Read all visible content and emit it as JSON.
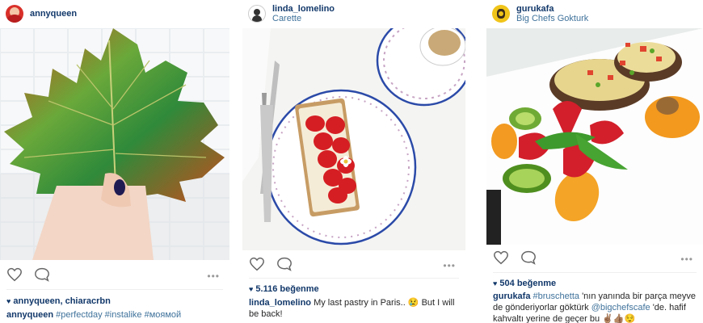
{
  "posts": [
    {
      "username": "annyqueen",
      "location": "",
      "likes_text": "annyqueen, chiaracrbn",
      "caption_user": "annyqueen",
      "caption_text": "#perfectday #instalike #моямой"
    },
    {
      "username": "linda_lomelino",
      "location": "Carette",
      "likes_text": "5.116 beğenme",
      "caption_user": "linda_lomelino",
      "caption_text": "My last pastry in Paris.. 😢 But I will be back!"
    },
    {
      "username": "gurukafa",
      "location": "Big Chefs Gokturk",
      "likes_text": "504 beğenme",
      "caption_user": "gurukafa",
      "caption_tag1": "#bruschetta",
      "caption_mid": "'nın yanında bir parça meyve de gönderiyorlar göktürk",
      "caption_mention": "@bigchefscafe",
      "caption_end": "'de. hafif kahvaltı yerine de geçer bu ✌🏽👍🏽😌"
    }
  ],
  "icons": {
    "like": "heart-outline-icon",
    "comment": "comment-bubble-icon",
    "more": "more-options-icon"
  },
  "more_glyph": "•••",
  "colors": {
    "username": "#12386a",
    "link": "#3f729b",
    "accent_orange": "#e25a1c"
  }
}
